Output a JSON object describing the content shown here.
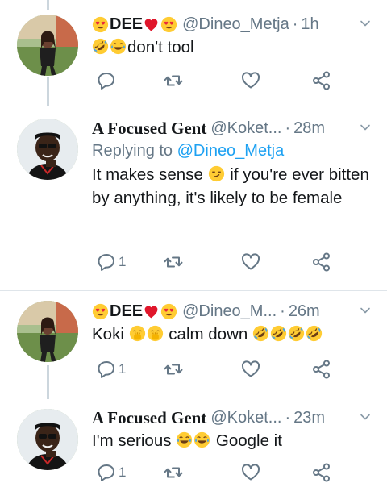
{
  "colors": {
    "text": "#14171a",
    "secondary": "#657786",
    "link": "#1da1f2",
    "separator": "#dfe5ea",
    "thread_line": "#ccd6dd"
  },
  "tweets": [
    {
      "display_name": "DEE",
      "name_emoji_before": "heart-eyes-emoji",
      "name_emoji_after": [
        "red-heart-emoji",
        "heart-eyes-emoji"
      ],
      "handle": "@Dineo_Metja",
      "separator": "·",
      "time": "1h",
      "text": "don't tool",
      "text_emoji_before": [
        "rofl-emoji",
        "tears-of-joy-emoji"
      ],
      "reply_count": "",
      "avatar": "woman-avatar"
    },
    {
      "display_name": "A Focused Gent",
      "handle": "@Koket...",
      "separator": "·",
      "time": "28m",
      "replying_label": "Replying to",
      "replying_to": "@Dineo_Metja",
      "text_part1": "It makes sense",
      "text_emoji": "smirk-emoji",
      "text_part2": "if you're ever bitten by anything, it's likely to be female",
      "reply_count": "1",
      "avatar": "man-avatar"
    },
    {
      "display_name": "DEE",
      "name_emoji_before": "heart-eyes-emoji",
      "name_emoji_after": [
        "red-heart-emoji",
        "heart-eyes-emoji"
      ],
      "handle": "@Dineo_M...",
      "separator": "·",
      "time": "26m",
      "text_part1": "Koki",
      "text_emoji_mid": [
        "hand-over-mouth-emoji",
        "hand-over-mouth-emoji"
      ],
      "text_part2": "calm down",
      "text_emoji_after": [
        "rofl-emoji",
        "rofl-emoji",
        "rofl-emoji",
        "rofl-emoji"
      ],
      "reply_count": "1",
      "avatar": "woman-avatar"
    },
    {
      "display_name": "A Focused Gent",
      "handle": "@Koket...",
      "separator": "·",
      "time": "23m",
      "text_part1": "I'm serious",
      "text_emoji_mid": [
        "tears-of-joy-emoji",
        "tears-of-joy-emoji"
      ],
      "text_part2": "Google it",
      "reply_count": "1",
      "avatar": "man-avatar"
    }
  ],
  "actions": {
    "reply_icon": "reply-icon",
    "retweet_icon": "retweet-icon",
    "like_icon": "heart-icon",
    "share_icon": "share-icon"
  }
}
